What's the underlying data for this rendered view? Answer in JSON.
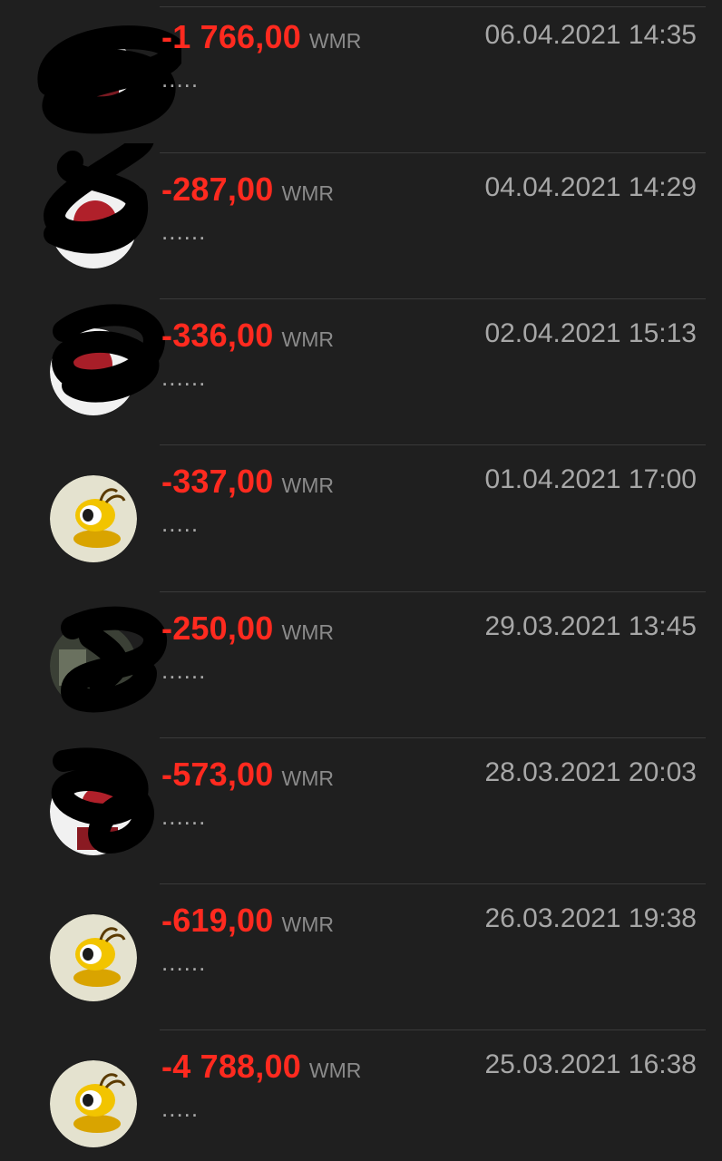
{
  "transactions": [
    {
      "amount": "-1 766,00",
      "currency": "WMR",
      "datetime": "06.04.2021 14:35",
      "description": ".....",
      "avatar": "redacted-photo"
    },
    {
      "amount": "-287,00",
      "currency": "WMR",
      "datetime": "04.04.2021 14:29",
      "description": "......",
      "avatar": "redacted-photo"
    },
    {
      "amount": "-336,00",
      "currency": "WMR",
      "datetime": "02.04.2021 15:13",
      "description": "......",
      "avatar": "redacted-photo"
    },
    {
      "amount": "-337,00",
      "currency": "WMR",
      "datetime": "01.04.2021 17:00",
      "description": ".....",
      "avatar": "webmoney-ant-icon"
    },
    {
      "amount": "-250,00",
      "currency": "WMR",
      "datetime": "29.03.2021 13:45",
      "description": "......",
      "avatar": "redacted-photo"
    },
    {
      "amount": "-573,00",
      "currency": "WMR",
      "datetime": "28.03.2021 20:03",
      "description": "......",
      "avatar": "redacted-photo"
    },
    {
      "amount": "-619,00",
      "currency": "WMR",
      "datetime": "26.03.2021 19:38",
      "description": "......",
      "avatar": "webmoney-ant-icon"
    },
    {
      "amount": "-4 788,00",
      "currency": "WMR",
      "datetime": "25.03.2021 16:38",
      "description": ".....",
      "avatar": "webmoney-ant-icon"
    }
  ],
  "colors": {
    "background": "#1f1f1f",
    "amount": "#ff2a1f",
    "secondary_text": "#a7a7a7",
    "separator": "#3a3a3a"
  }
}
